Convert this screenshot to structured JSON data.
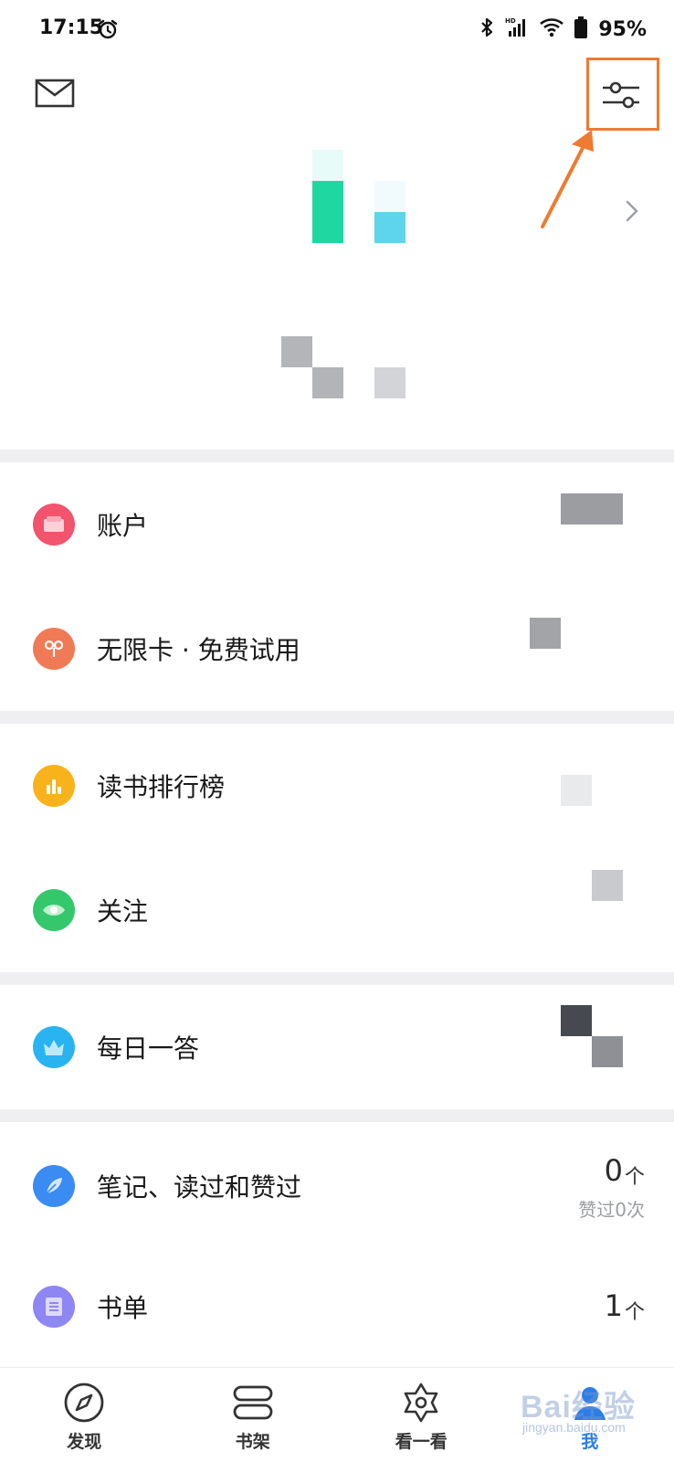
{
  "status_bar": {
    "time": "17:15",
    "battery": "95%",
    "icons": [
      "alarm-icon",
      "bluetooth-icon",
      "hd-signal-icon",
      "wifi-icon",
      "battery-icon"
    ]
  },
  "header": {
    "icons": [
      "mail-icon",
      "settings-sliders-icon",
      "chevron-right-icon"
    ],
    "highlight_color": "#ef7a31"
  },
  "menu": {
    "account": {
      "label": "账户",
      "icon": "wallet-icon",
      "color": "#f2536d"
    },
    "unlimited": {
      "label": "无限卡 · 免费试用",
      "icon": "infinity-icon",
      "color": "#f07a56"
    },
    "ranking": {
      "label": "读书排行榜",
      "icon": "bar-chart-icon",
      "color": "#f8b21b"
    },
    "follow": {
      "label": "关注",
      "icon": "eye-icon",
      "color": "#35c76b"
    },
    "daily_quiz": {
      "label": "每日一答",
      "icon": "crown-icon",
      "color": "#29b3f0"
    },
    "notes": {
      "label": "笔记、读过和赞过",
      "icon": "feather-icon",
      "color": "#3a8bf2",
      "count": "0",
      "unit": "个",
      "sub": "赞过0次"
    },
    "booklist": {
      "label": "书单",
      "icon": "list-icon",
      "color": "#8e86f2",
      "count": "1",
      "unit": "个"
    }
  },
  "bottom_nav": {
    "items": [
      {
        "label": "发现",
        "icon": "compass-icon"
      },
      {
        "label": "书架",
        "icon": "bookshelf-icon"
      },
      {
        "label": "看一看",
        "icon": "star-look-icon"
      },
      {
        "label": "我",
        "icon": "profile-icon",
        "active": true
      }
    ],
    "active_color": "#2b7de9"
  },
  "watermark": {
    "text": "Bai经验",
    "sub": "jingyan.baidu.com"
  }
}
